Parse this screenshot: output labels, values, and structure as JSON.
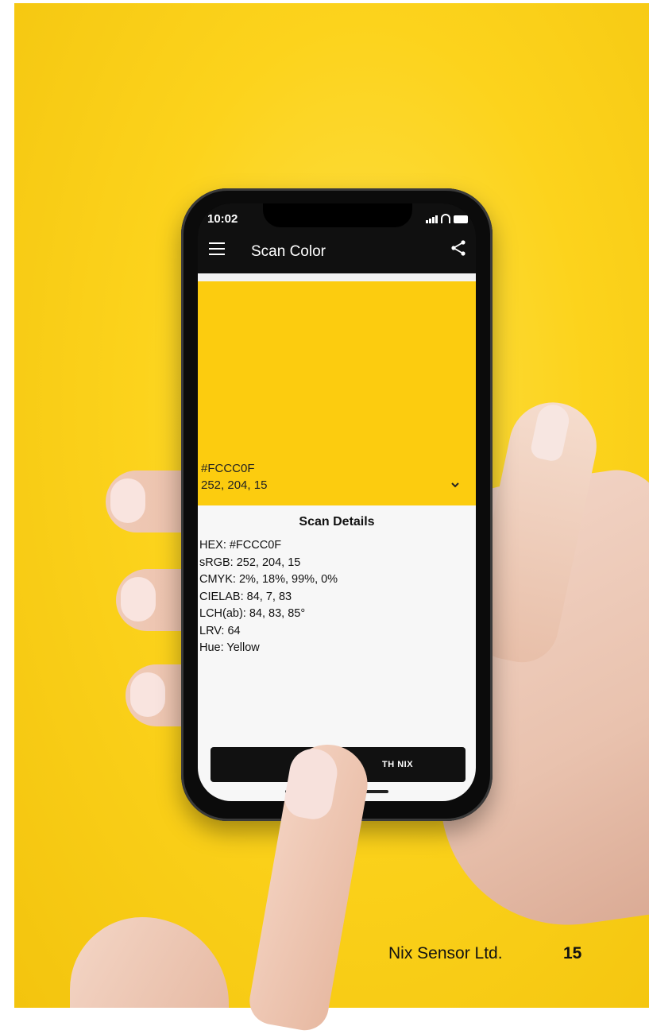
{
  "colors": {
    "background": "#FCD31C",
    "scanned_swatch": "#FCCC0F",
    "app_bar": "#101010",
    "details_background": "#F7F7F7"
  },
  "phone": {
    "status_bar": {
      "time": "10:02",
      "icons": [
        "signal-icon",
        "wifi-icon",
        "battery-icon"
      ]
    },
    "app_bar": {
      "menu_icon": "menu-icon",
      "title": "Scan Color",
      "share_icon": "share-icon"
    },
    "swatch": {
      "hex": "#FCCC0F",
      "rgb": "252, 204, 15",
      "expand_icon": "chevron-down-icon"
    },
    "details": {
      "title": "Scan Details",
      "rows": [
        "HEX: #FCCC0F",
        "sRGB: 252, 204, 15",
        "CMYK: 2%, 18%, 99%, 0%",
        "CIELAB: 84, 7, 83",
        "LCH(ab): 84, 83, 85°",
        "LRV: 64",
        "Hue: Yellow"
      ]
    },
    "action_button": {
      "label": "TH NIX"
    }
  },
  "footer": {
    "company": "Nix Sensor Ltd.",
    "page_number": "15"
  }
}
